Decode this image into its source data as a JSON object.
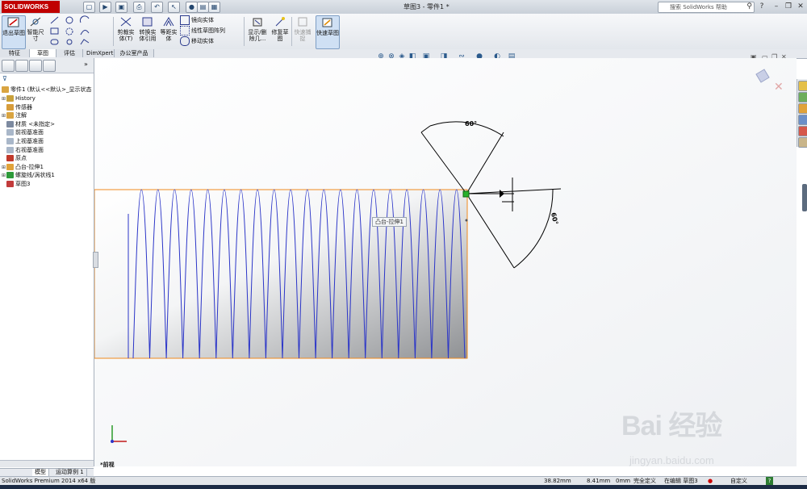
{
  "titlebar": {
    "logo": "SOLIDWORKS",
    "document_title": "草图3 - 零件1 *",
    "search_placeholder": "搜索 SolidWorks 帮助",
    "colors": {
      "brand": "#c00000"
    }
  },
  "command_manager": {
    "sketch_tools": {
      "exit_sketch": "退出草图",
      "smart_dimension": "智能尺寸",
      "trim_entities": "剪裁实体(T)",
      "convert_entities": "转换实体引用",
      "offset_entities": "等距实体",
      "mirror_entities": "镜向实体",
      "linear_pattern": "线性草图阵列",
      "move_entities": "移动实体",
      "display_delete_relations": "显示/删除几...",
      "repair_sketch": "修复草图",
      "quick_snaps": "快速捕捉",
      "rapid_sketch": "快速草图"
    }
  },
  "tabs": [
    {
      "label": "特征",
      "active": false
    },
    {
      "label": "草图",
      "active": true
    },
    {
      "label": "评估",
      "active": false
    },
    {
      "label": "DimXpert",
      "active": false
    },
    {
      "label": "办公室产品",
      "active": false
    }
  ],
  "feature_tree": {
    "root": "零件1 (默认<<默认>_显示状态",
    "items": [
      {
        "label": "History",
        "icon": "history-icon",
        "expandable": true
      },
      {
        "label": "传感器",
        "icon": "sensor-icon",
        "expandable": false
      },
      {
        "label": "注解",
        "icon": "annotation-icon",
        "expandable": true
      },
      {
        "label": "材质 <未指定>",
        "icon": "material-icon",
        "expandable": false
      },
      {
        "label": "前视基准面",
        "icon": "plane-icon",
        "expandable": false
      },
      {
        "label": "上视基准面",
        "icon": "plane-icon",
        "expandable": false
      },
      {
        "label": "右视基准面",
        "icon": "plane-icon",
        "expandable": false
      },
      {
        "label": "原点",
        "icon": "origin-icon",
        "expandable": false
      },
      {
        "label": "凸台-拉伸1",
        "icon": "extrude-icon",
        "expandable": true
      },
      {
        "label": "螺旋线/涡状线1",
        "icon": "helix-icon",
        "expandable": true
      },
      {
        "label": "草图3",
        "icon": "sketch-icon",
        "expandable": false
      }
    ]
  },
  "bottom_tabs": [
    {
      "label": "模型"
    },
    {
      "label": "运动算例 1"
    }
  ],
  "viewport": {
    "tooltip": "凸台-拉伸1",
    "view_label": "*前视",
    "dimension_angle_top": "60°",
    "dimension_angle_right": "60°",
    "helix_turns": 20,
    "colors": {
      "helix": "#2b35c8",
      "edge": "#f08a1e",
      "dimension": "#000000"
    }
  },
  "statusbar": {
    "product": "SolidWorks Premium 2014 x64 版",
    "coord_x": "38.82mm",
    "coord_y": "8.41mm",
    "coord_z": "0mm",
    "sketch_state": "完全定义",
    "editing": "在编辑 草图3",
    "units": "自定义",
    "help": "?"
  },
  "watermark": {
    "logo": "Bai 经验",
    "url": "jingyan.baidu.com"
  }
}
